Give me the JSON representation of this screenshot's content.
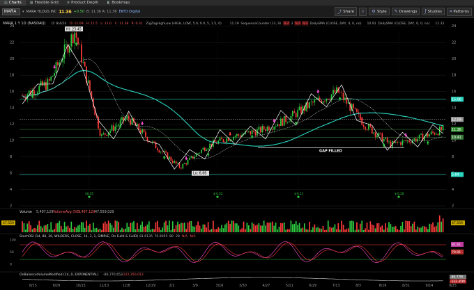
{
  "tabs": [
    {
      "label": "Charts",
      "icon": "chart-icon",
      "active": true
    },
    {
      "label": "Flexible Grid",
      "icon": "grid-icon",
      "active": false
    },
    {
      "label": "Product Depth",
      "icon": "depth-icon",
      "active": false
    },
    {
      "label": "Bookmap",
      "icon": "bookmap-icon",
      "active": false
    }
  ],
  "toolbar": {
    "symbol": "MARA",
    "name": "MARA HLDGS INC",
    "price": "11.36",
    "change": "+0.50",
    "bid_ask": "B: 11.36  A: 11.36",
    "link": "EKTO Digital",
    "share": "Share",
    "style": "Style",
    "drawings": "Drawings",
    "studies": "Studies",
    "patterns": "Patterns"
  },
  "study_bar": {
    "label": "MARA 1 Y 1D (NASDAQ)",
    "items": [
      {
        "text": "D: 8/4/24",
        "tone": "plain"
      },
      {
        "text": "O: 11.09",
        "tone": "red"
      },
      {
        "text": "H: 11.5",
        "tone": "red"
      },
      {
        "text": "L: 11.0",
        "tone": "red"
      },
      {
        "text": "C: 11.36",
        "tone": "red"
      },
      {
        "text": "R: 0.31",
        "tone": "red"
      },
      {
        "text": "ZigZagHighLow (HIGH, LOW, 5.0, 0.0, 5, 1.5, 0)",
        "tone": "plain"
      },
      {
        "text": "11.19",
        "tone": "plain"
      },
      {
        "text": "SequenceCounter (13, 9)",
        "tone": "plain"
      },
      {
        "text": "N/A",
        "tone": "na"
      },
      {
        "text": "2",
        "tone": "plain"
      },
      {
        "text": "N/A",
        "tone": "na"
      },
      {
        "text": "N/A",
        "tone": "na"
      },
      {
        "text": "DailySMA (CLOSE, DAY, 4, 0, no)",
        "tone": "plain"
      },
      {
        "text": "10.91",
        "tone": "plain"
      },
      {
        "text": "DailySMA (CLOSE, DAY, 0, 0, no)",
        "tone": "plain"
      },
      {
        "text": "11.31",
        "tone": "plain"
      }
    ]
  },
  "price_axis": {
    "ticks": [
      "24",
      "22",
      "20",
      "18",
      "16",
      "14",
      "12",
      "10",
      "8",
      "6",
      "4",
      "2"
    ],
    "badges": [
      {
        "value": "15.06",
        "color": "#2bd6c0"
      },
      {
        "value": "12.59",
        "color": "#9a9a9a"
      },
      {
        "value": "11.36",
        "color": "#2e8b2e"
      },
      {
        "value": "10.41",
        "color": "#3a7a3a"
      },
      {
        "value": "5.84",
        "color": "#2bd6c0"
      }
    ]
  },
  "annotations": {
    "high": "Hi: 23.45",
    "low": "Lo: 6.66",
    "gap": "GAP FILLED",
    "earnings": [
      "$0.35",
      "$-0.52",
      "$-0.11",
      "$-0.26"
    ]
  },
  "date_axis": {
    "ticks": [
      "8/15",
      "9/29",
      "10/13",
      "11/13",
      "12/8",
      "12/29",
      "2/2",
      "3/9",
      "3/16",
      "3/30",
      "4/27",
      "5/11",
      "6/29",
      "7/13",
      "8/3",
      "8/16",
      "8/31",
      "9/14",
      "9/25"
    ]
  },
  "volume_panel": {
    "title": "Volume",
    "value": "5,497,129",
    "avg_label": "VolumeAvg (50)",
    "avg_value": "5,497,129",
    "last": "47,559,029",
    "badge": "47.559"
  },
  "stoch_panel": {
    "title": "StochRSI (14, 80, 20, WILDERS, CLOSE, 14, 3, 1, SIMPLE, On FullK & FullD)",
    "values": [
      "81.6135",
      "70.9055",
      "80",
      "20",
      "N/A",
      "N/A"
    ],
    "ticks": [
      "100",
      "50",
      "0"
    ],
    "badges": [
      "81.61",
      "70.91"
    ]
  },
  "obv_panel": {
    "title": "OnBalanceVolumeModified (14, 0, EXPONENTIAL)",
    "values": [
      "-86,770,653",
      "-122,350,012"
    ],
    "ticks": [
      "100M",
      "0",
      "-100M"
    ],
    "badges": [
      "-86.77M",
      "-122.35M"
    ]
  },
  "chart_data": [
    {
      "type": "candlestick",
      "title": "MARA 1 Y 1D (NASDAQ)",
      "x": [
        "8/15",
        "9/29",
        "10/13",
        "11/13",
        "12/8",
        "12/29",
        "2/2",
        "3/9",
        "3/16",
        "3/30",
        "4/27",
        "5/11",
        "6/29",
        "7/13",
        "8/3",
        "8/16",
        "8/31"
      ],
      "close": [
        15.5,
        17.0,
        23.4,
        10.5,
        12.8,
        9.5,
        6.7,
        9.3,
        10.5,
        11.2,
        12.5,
        14.5,
        16.0,
        12.0,
        9.5,
        10.2,
        11.36
      ],
      "series": [
        {
          "name": "DailySMA (CLOSE, DAY, 4, 0, no)",
          "last": 10.91,
          "color": "#2bd6c0"
        },
        {
          "name": "DailySMA (CLOSE, DAY, 0, 0, no)",
          "last": 11.31,
          "color": "#bbbbbb"
        },
        {
          "name": "ZigZagHighLow (HIGH, LOW, 5.0, 0.0, 5, 1.5, 0)",
          "last": 11.19,
          "color": "#ffffff"
        }
      ],
      "horizontal_lines": [
        15.06,
        12.59,
        11.36,
        10.41,
        5.84
      ],
      "ylim": [
        2,
        25
      ]
    }
  ]
}
